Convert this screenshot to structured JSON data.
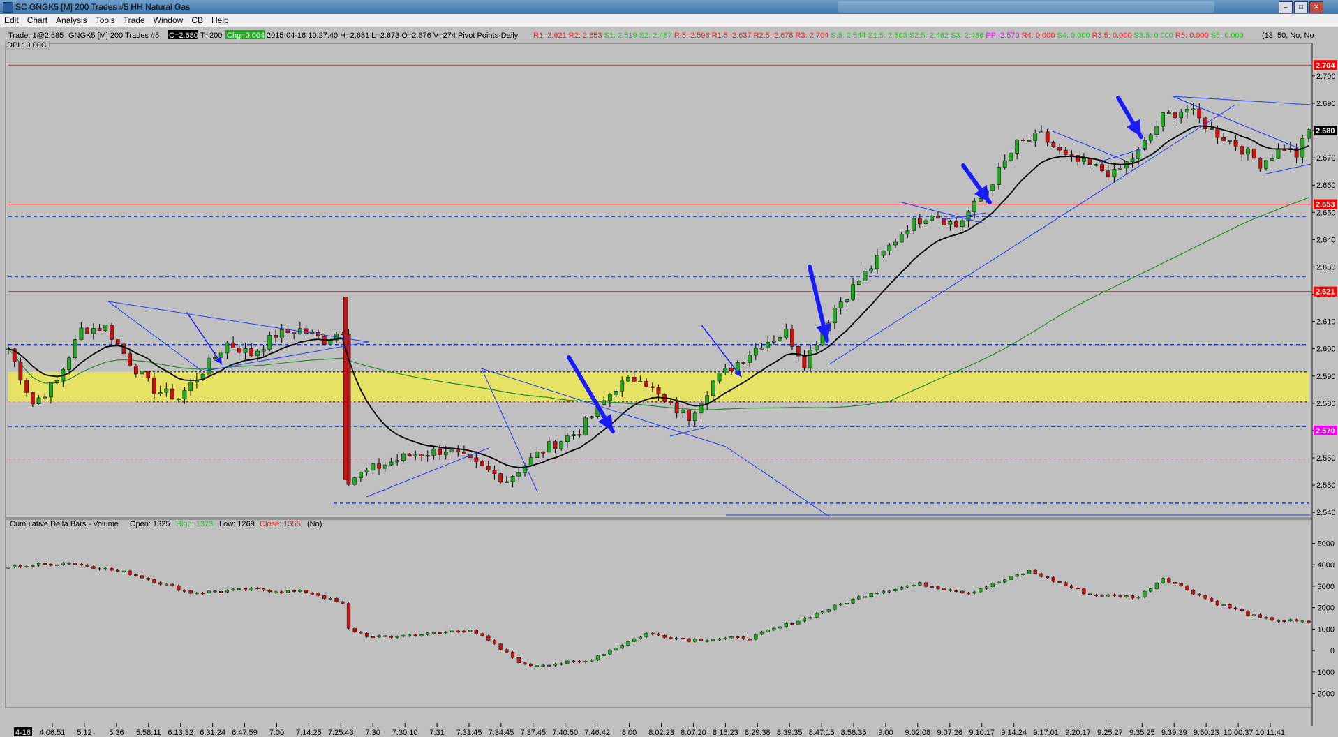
{
  "window": {
    "title": "SC GNGK5 [M]  200 Trades  #5  HH Natural Gas",
    "minimize": "–",
    "maximize": "□",
    "close": "✕"
  },
  "menu": [
    "Edit",
    "Chart",
    "Analysis",
    "Tools",
    "Trade",
    "Window",
    "CB",
    "Help"
  ],
  "header": {
    "trade": "Trade: 1@2.685",
    "symbol": "GNGK5 [M]  200 Trades  #5",
    "close_badge": "C=2.680",
    "trades": "T=200",
    "change_badge": "Chg=0.004",
    "ohlc": "2015-04-16 10:27:40 H=2.681 L=2.673 O=2.676 V=274 Pivot Points-Daily",
    "settings": "(13, 50, No, No",
    "dpl": "DPL: 0.00C",
    "pivots": [
      {
        "text": "R1: 2.621",
        "color": "#ff2020"
      },
      {
        "text": "R2: 2.653",
        "color": "#ff2020"
      },
      {
        "text": "S1: 2.519",
        "color": "#22cc22"
      },
      {
        "text": "S2: 2.487",
        "color": "#22cc22"
      },
      {
        "text": "R.5: 2.596",
        "color": "#ff2020"
      },
      {
        "text": "R1.5: 2.637",
        "color": "#ff2020"
      },
      {
        "text": "R2.5: 2.678",
        "color": "#ff2020"
      },
      {
        "text": "R3: 2.704",
        "color": "#ff2020"
      },
      {
        "text": "S.5: 2.544",
        "color": "#22cc22"
      },
      {
        "text": "S1.5: 2.503",
        "color": "#22cc22"
      },
      {
        "text": "S2.5: 2.462",
        "color": "#22cc22"
      },
      {
        "text": "S3: 2.436",
        "color": "#22cc22"
      },
      {
        "text": "PP: 2.570",
        "color": "#ff00ff"
      },
      {
        "text": "R4: 0.000",
        "color": "#ff2020"
      },
      {
        "text": "S4: 0.000",
        "color": "#22cc22"
      },
      {
        "text": "R3.5: 0.000",
        "color": "#ff2020"
      },
      {
        "text": "S3.5: 0.000",
        "color": "#22cc22"
      },
      {
        "text": "R5: 0.000",
        "color": "#ff2020"
      },
      {
        "text": "S5: 0.000",
        "color": "#22cc22"
      }
    ]
  },
  "price_axis": {
    "ticks": [
      "2.700",
      "2.690",
      "2.680",
      "2.670",
      "2.660",
      "2.650",
      "2.640",
      "2.630",
      "2.620",
      "2.610",
      "2.600",
      "2.590",
      "2.580",
      "2.570",
      "2.560",
      "2.550",
      "2.540"
    ],
    "tick_values": [
      2.7,
      2.69,
      2.68,
      2.67,
      2.66,
      2.65,
      2.64,
      2.63,
      2.62,
      2.61,
      2.6,
      2.59,
      2.58,
      2.57,
      2.56,
      2.55,
      2.54
    ],
    "markers": [
      {
        "text": "2.704",
        "value": 2.704,
        "bg": "#ff0000",
        "fg": "#ffffff"
      },
      {
        "text": "2.680",
        "value": 2.68,
        "bg": "#000000",
        "fg": "#ffffff"
      },
      {
        "text": "2.653",
        "value": 2.653,
        "bg": "#ff0000",
        "fg": "#ffffff"
      },
      {
        "text": "2.621",
        "value": 2.621,
        "bg": "#ff0000",
        "fg": "#ffffff"
      },
      {
        "text": "2.570",
        "value": 2.57,
        "bg": "#ff00ff",
        "fg": "#ffffff"
      }
    ]
  },
  "levels": {
    "red": [
      2.704,
      2.653,
      2.621
    ],
    "dashed_blue": [
      2.6485,
      2.6265,
      2.6014,
      2.5715,
      2.5434
    ],
    "magenta_dashed": [
      2.5805,
      2.5595
    ],
    "zone": {
      "high": 2.5915,
      "low": 2.5805,
      "color": "#e6e266"
    }
  },
  "delta_panel": {
    "label": "Cumulative Delta Bars - Volume",
    "open": "Open: 1325",
    "high": "High: 1373",
    "low": "Low: 1269",
    "close": "Close: 1355",
    "flag": "(No)",
    "ticks": [
      "5000",
      "4000",
      "3000",
      "2000",
      "1000",
      "0",
      "-1000",
      "-2000"
    ],
    "tick_values": [
      5000,
      4000,
      3000,
      2000,
      1000,
      0,
      -1000,
      -2000
    ]
  },
  "time_axis": {
    "start_badge": "4-16",
    "labels": [
      "4:06:51",
      "5:12",
      "5:36",
      "5:58:11",
      "6:13:32",
      "6:31:24",
      "6:47:59",
      "7:00",
      "7:14:25",
      "7:25:43",
      "7:30",
      "7:30:10",
      "7:31",
      "7:31:45",
      "7:34:45",
      "7:37:45",
      "7:40:50",
      "7:46:42",
      "8:00",
      "8:02:23",
      "8:07:20",
      "8:16:23",
      "8:29:38",
      "8:39:35",
      "8:47:15",
      "8:58:35",
      "9:00",
      "9:02:08",
      "9:07:26",
      "9:10:17",
      "9:14:24",
      "9:17:01",
      "9:20:17",
      "9:25:27",
      "9:35:25",
      "9:39:39",
      "9:50:23",
      "10:00:37",
      "10:11:41"
    ]
  },
  "chart_data": {
    "type": "candlestick",
    "price_range": [
      2.538,
      2.712
    ],
    "price_anchors": [
      {
        "i": 0,
        "p": 2.6
      },
      {
        "i": 4,
        "p": 2.58
      },
      {
        "i": 8,
        "p": 2.588
      },
      {
        "i": 12,
        "p": 2.607
      },
      {
        "i": 16,
        "p": 2.608
      },
      {
        "i": 20,
        "p": 2.595
      },
      {
        "i": 24,
        "p": 2.585
      },
      {
        "i": 28,
        "p": 2.582
      },
      {
        "i": 32,
        "p": 2.592
      },
      {
        "i": 36,
        "p": 2.602
      },
      {
        "i": 40,
        "p": 2.598
      },
      {
        "i": 44,
        "p": 2.605
      },
      {
        "i": 48,
        "p": 2.607
      },
      {
        "i": 52,
        "p": 2.603
      },
      {
        "i": 55,
        "p": 2.607
      },
      {
        "i": 56,
        "p": 2.552
      },
      {
        "i": 60,
        "p": 2.556
      },
      {
        "i": 66,
        "p": 2.561
      },
      {
        "i": 72,
        "p": 2.563
      },
      {
        "i": 78,
        "p": 2.556
      },
      {
        "i": 82,
        "p": 2.552
      },
      {
        "i": 88,
        "p": 2.563
      },
      {
        "i": 94,
        "p": 2.57
      },
      {
        "i": 100,
        "p": 2.586
      },
      {
        "i": 104,
        "p": 2.59
      },
      {
        "i": 108,
        "p": 2.58
      },
      {
        "i": 112,
        "p": 2.575
      },
      {
        "i": 116,
        "p": 2.588
      },
      {
        "i": 120,
        "p": 2.595
      },
      {
        "i": 124,
        "p": 2.602
      },
      {
        "i": 128,
        "p": 2.606
      },
      {
        "i": 131,
        "p": 2.595
      },
      {
        "i": 136,
        "p": 2.615
      },
      {
        "i": 142,
        "p": 2.63
      },
      {
        "i": 148,
        "p": 2.645
      },
      {
        "i": 152,
        "p": 2.65
      },
      {
        "i": 156,
        "p": 2.645
      },
      {
        "i": 160,
        "p": 2.655
      },
      {
        "i": 166,
        "p": 2.675
      },
      {
        "i": 170,
        "p": 2.678
      },
      {
        "i": 174,
        "p": 2.67
      },
      {
        "i": 178,
        "p": 2.667
      },
      {
        "i": 182,
        "p": 2.664
      },
      {
        "i": 186,
        "p": 2.672
      },
      {
        "i": 190,
        "p": 2.685
      },
      {
        "i": 194,
        "p": 2.688
      },
      {
        "i": 198,
        "p": 2.68
      },
      {
        "i": 202,
        "p": 2.675
      },
      {
        "i": 206,
        "p": 2.668
      },
      {
        "i": 210,
        "p": 2.674
      },
      {
        "i": 212,
        "p": 2.671
      },
      {
        "i": 214,
        "p": 2.68
      }
    ],
    "delta_range": [
      -2600,
      5600
    ],
    "delta_anchors": [
      {
        "i": 0,
        "p": 3900
      },
      {
        "i": 10,
        "p": 4100
      },
      {
        "i": 20,
        "p": 3600
      },
      {
        "i": 30,
        "p": 2700
      },
      {
        "i": 40,
        "p": 2850
      },
      {
        "i": 50,
        "p": 2700
      },
      {
        "i": 55,
        "p": 2150
      },
      {
        "i": 56,
        "p": 1000
      },
      {
        "i": 60,
        "p": 600
      },
      {
        "i": 70,
        "p": 800
      },
      {
        "i": 76,
        "p": 1000
      },
      {
        "i": 85,
        "p": -700
      },
      {
        "i": 95,
        "p": -500
      },
      {
        "i": 105,
        "p": 800
      },
      {
        "i": 112,
        "p": 500
      },
      {
        "i": 122,
        "p": 600
      },
      {
        "i": 130,
        "p": 1400
      },
      {
        "i": 142,
        "p": 2700
      },
      {
        "i": 150,
        "p": 3100
      },
      {
        "i": 158,
        "p": 2700
      },
      {
        "i": 168,
        "p": 3700
      },
      {
        "i": 178,
        "p": 2600
      },
      {
        "i": 186,
        "p": 2500
      },
      {
        "i": 190,
        "p": 3400
      },
      {
        "i": 198,
        "p": 2300
      },
      {
        "i": 206,
        "p": 1500
      },
      {
        "i": 214,
        "p": 1300
      }
    ],
    "candle_count": 215,
    "ema_color": "#000000",
    "sma_color": "#2a8a2a",
    "bull_color": "#22aa22",
    "bear_color": "#cc1111"
  }
}
